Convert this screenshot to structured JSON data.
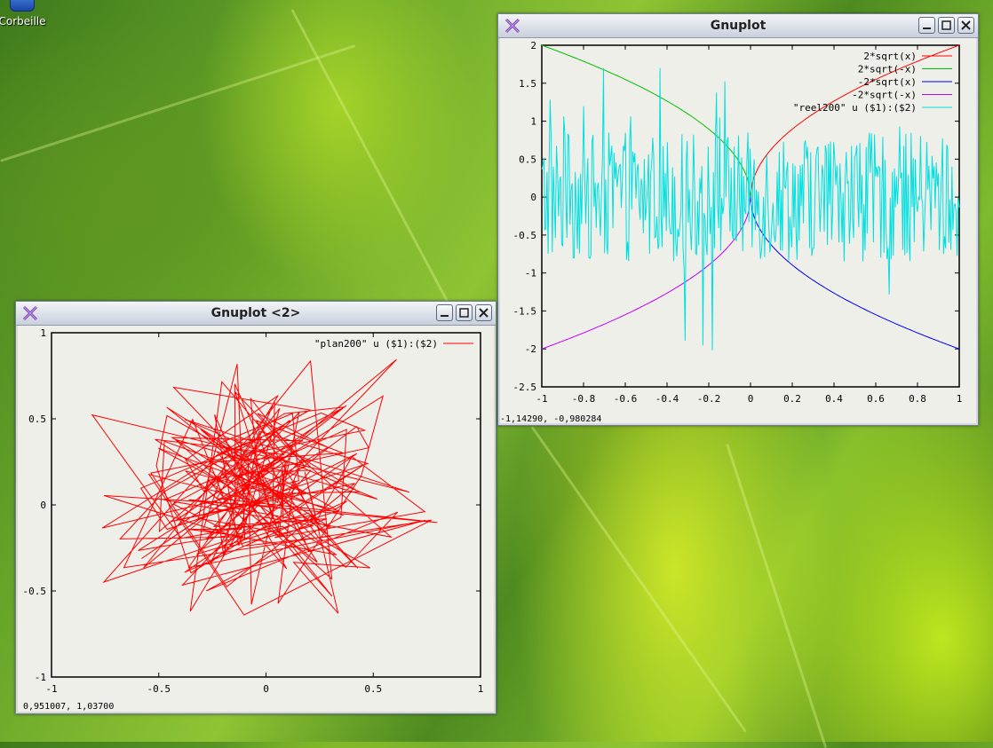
{
  "desktop": {
    "trash_label": "Corbeille"
  },
  "window_right": {
    "title": "Gnuplot",
    "status": "-1,14290, -0,980284",
    "chart_data": {
      "type": "line",
      "xlim": [
        -1,
        1
      ],
      "ylim": [
        -2.5,
        2
      ],
      "x_ticks": [
        "-1",
        "-0.8",
        "-0.6",
        "-0.4",
        "-0.2",
        "0",
        "0.2",
        "0.4",
        "0.6",
        "0.8",
        "1"
      ],
      "y_ticks": [
        "2",
        "1.5",
        "1",
        "0.5",
        "0",
        "-0.5",
        "-1",
        "-1.5",
        "-2",
        "-2.5"
      ],
      "legend_position": "top-right",
      "series": [
        {
          "name": "2*sqrt(x)",
          "color": "#ff0000",
          "formula": "2*sqrt(x)",
          "domain": [
            0,
            1
          ]
        },
        {
          "name": "2*sqrt(-x)",
          "color": "#00c000",
          "formula": "2*sqrt(-x)",
          "domain": [
            -1,
            0
          ]
        },
        {
          "name": "-2*sqrt(x)",
          "color": "#0000ff",
          "formula": "-2*sqrt(x)",
          "domain": [
            0,
            1
          ]
        },
        {
          "name": "-2*sqrt(-x)",
          "color": "#c000ff",
          "formula": "-2*sqrt(-x)",
          "domain": [
            -1,
            0
          ]
        },
        {
          "name": "\"reel200\" u ($1):($2)",
          "color": "#00e0e0",
          "kind": "noise",
          "points": 400,
          "amplitude_range": [
            -2.3,
            1.7
          ]
        }
      ]
    }
  },
  "window_left": {
    "title": "Gnuplot <2>",
    "status": "0,951007,  1,03700",
    "chart_data": {
      "type": "line",
      "xlim": [
        -1,
        1
      ],
      "ylim": [
        -1,
        1
      ],
      "x_ticks": [
        "-1",
        "-0.5",
        "0",
        "0.5",
        "1"
      ],
      "y_ticks": [
        "1",
        "0.5",
        "0",
        "-0.5",
        "-1"
      ],
      "legend_position": "top-right",
      "series": [
        {
          "name": "\"plan200\" u ($1):($2)",
          "color": "#ff0000",
          "kind": "random-walk",
          "points": 200
        }
      ]
    }
  }
}
